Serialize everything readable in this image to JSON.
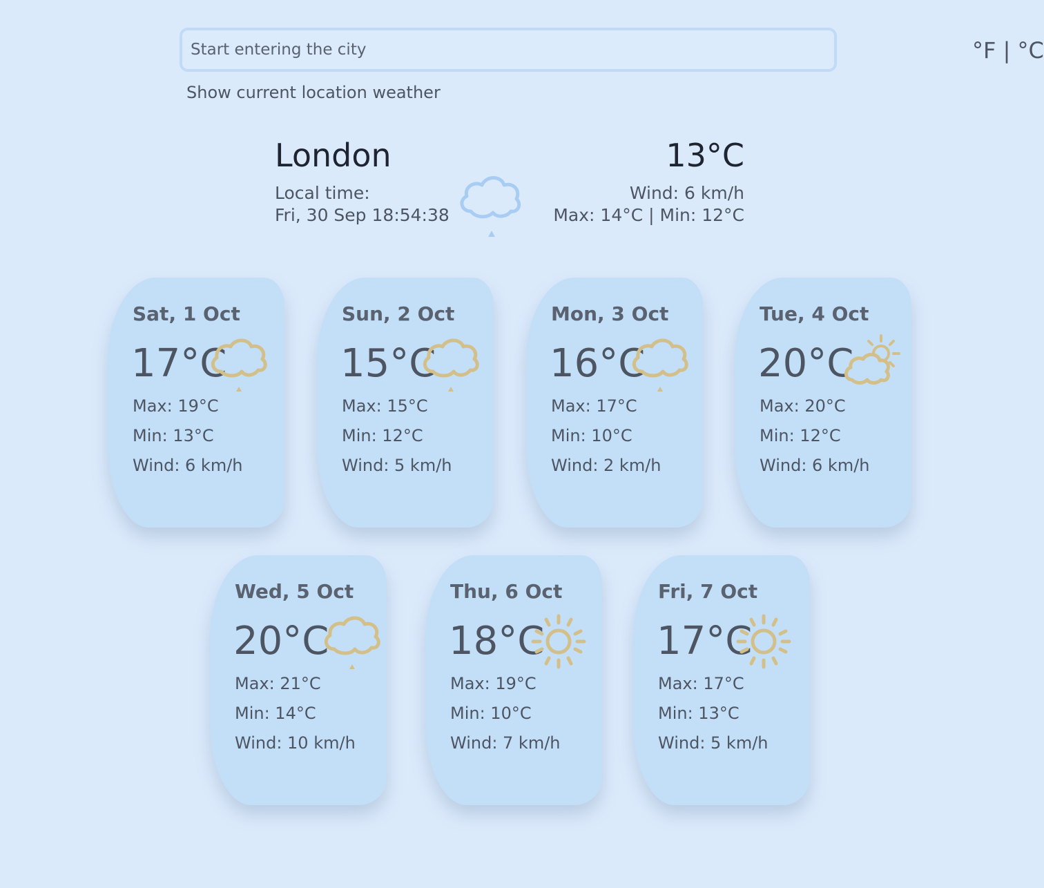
{
  "search": {
    "placeholder": "Start entering the city"
  },
  "units": {
    "fahrenheit": "°F",
    "separator": "|",
    "celsius": "°C"
  },
  "current_location_link": "Show current location weather",
  "current": {
    "city": "London",
    "local_time_label": "Local time:",
    "local_time": "Fri, 30 Sep 18:54:38",
    "temp": "13°C",
    "wind": "Wind: 6 km/h",
    "maxmin": "Max: 14°C | Min: 12°C",
    "icon": "cloud-rain-icon"
  },
  "forecast": [
    {
      "day": "Sat, 1 Oct",
      "temp": "17°C",
      "max": "Max: 19°C",
      "min": "Min: 13°C",
      "wind": "Wind: 6 km/h",
      "icon": "cloud-rain-icon"
    },
    {
      "day": "Sun, 2 Oct",
      "temp": "15°C",
      "max": "Max: 15°C",
      "min": "Min: 12°C",
      "wind": "Wind: 5 km/h",
      "icon": "cloud-rain-icon"
    },
    {
      "day": "Mon, 3 Oct",
      "temp": "16°C",
      "max": "Max: 17°C",
      "min": "Min: 10°C",
      "wind": "Wind: 2 km/h",
      "icon": "cloud-rain-icon"
    },
    {
      "day": "Tue, 4 Oct",
      "temp": "20°C",
      "max": "Max: 20°C",
      "min": "Min: 12°C",
      "wind": "Wind: 6 km/h",
      "icon": "partly-cloudy-icon"
    },
    {
      "day": "Wed, 5 Oct",
      "temp": "20°C",
      "max": "Max: 21°C",
      "min": "Min: 14°C",
      "wind": "Wind: 10 km/h",
      "icon": "cloud-rain-icon"
    },
    {
      "day": "Thu, 6 Oct",
      "temp": "18°C",
      "max": "Max: 19°C",
      "min": "Min: 10°C",
      "wind": "Wind: 7 km/h",
      "icon": "sun-icon"
    },
    {
      "day": "Fri, 7 Oct",
      "temp": "17°C",
      "max": "Max: 17°C",
      "min": "Min: 13°C",
      "wind": "Wind: 5 km/h",
      "icon": "sun-icon"
    }
  ],
  "colors": {
    "background": "#dbeafb",
    "card": "#c3dff8",
    "icon_forecast": "#d3bf8a",
    "icon_current": "#a9cdf2"
  }
}
